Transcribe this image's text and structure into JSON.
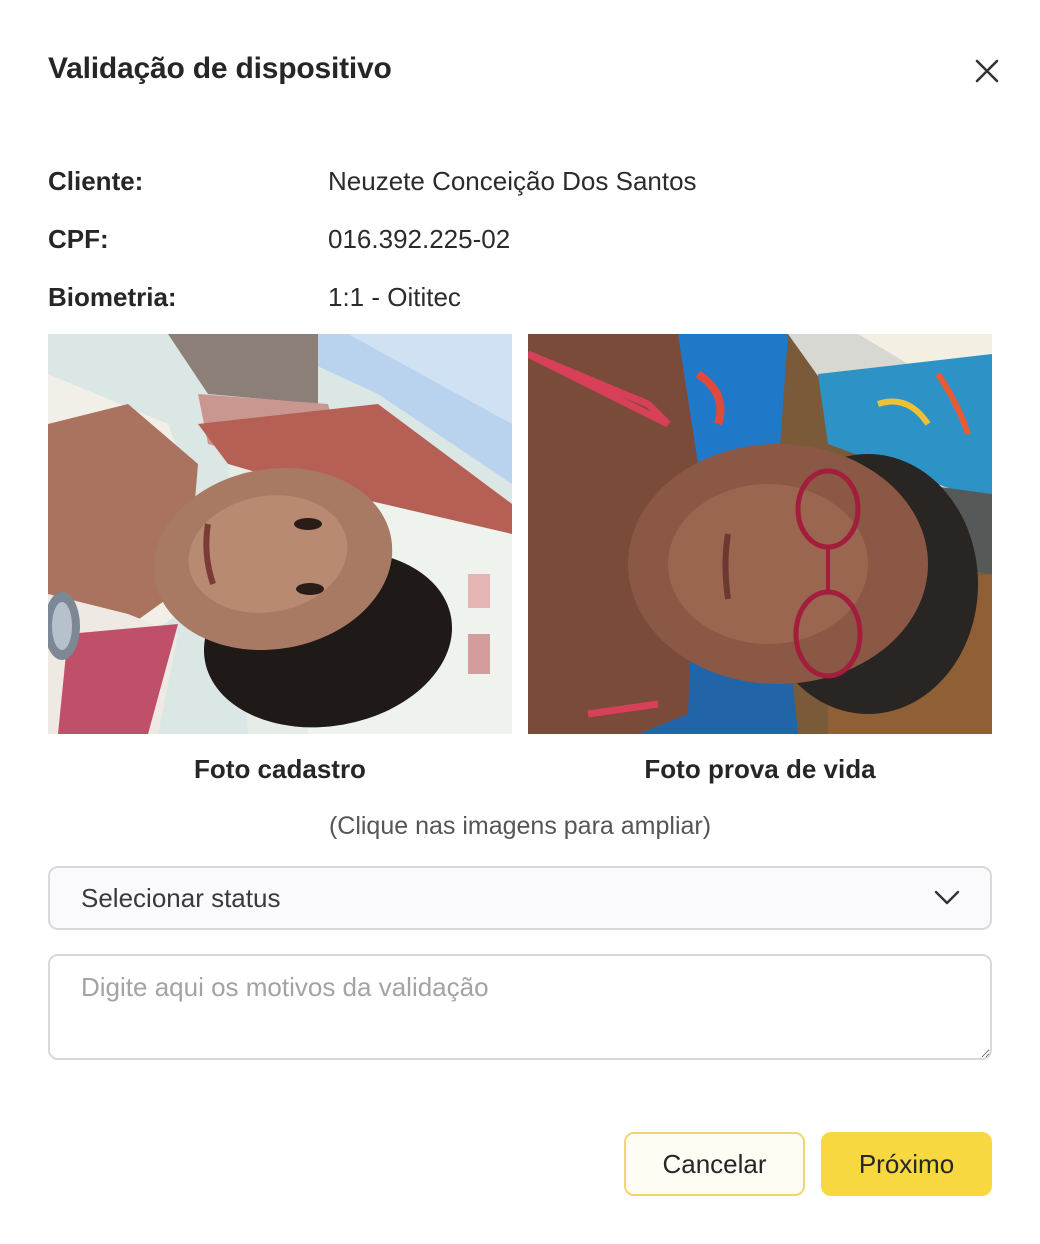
{
  "modal": {
    "title": "Validação de dispositivo"
  },
  "client_info": {
    "client_label": "Cliente:",
    "client_value": "Neuzete Conceição Dos Santos",
    "cpf_label": "CPF:",
    "cpf_value": "016.392.225-02",
    "biometry_label": "Biometria:",
    "biometry_value": "1:1 - Oititec"
  },
  "photos": {
    "registration_caption": "Foto cadastro",
    "liveness_caption": "Foto prova de vida",
    "hint": "(Clique nas imagens para ampliar)"
  },
  "status_select": {
    "value": "Selecionar status",
    "icon": "chevron-down-icon"
  },
  "reason": {
    "placeholder": "Digite aqui os motivos da validação",
    "value": ""
  },
  "actions": {
    "cancel_label": "Cancelar",
    "next_label": "Próximo"
  },
  "colors": {
    "primary": "#f7d840",
    "cancel_border": "#efd66e",
    "cancel_bg": "#fffdf3",
    "border": "#d9d9d9"
  }
}
